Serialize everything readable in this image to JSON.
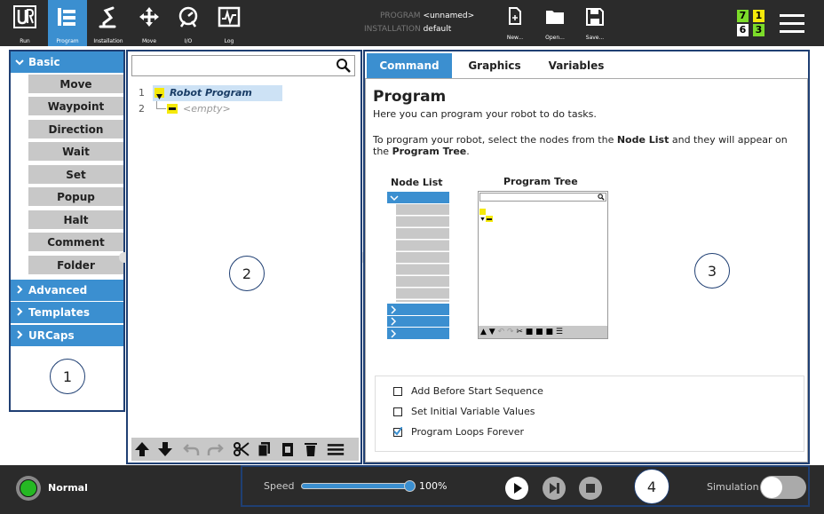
{
  "toolbar": {
    "run_label": "Run",
    "program_label": "Program",
    "installation_label": "Installation",
    "move_label": "Move",
    "io_label": "I/O",
    "log_label": "Log"
  },
  "program_info": {
    "program_key": "PROGRAM",
    "program_value": "<unnamed>",
    "installation_key": "INSTALLATION",
    "installation_value": "default"
  },
  "file_buttons": {
    "new_label": "New...",
    "open_label": "Open...",
    "save_label": "Save..."
  },
  "status_numbers": {
    "a": "7",
    "b": "1",
    "c": "6",
    "d": "3",
    "colors": {
      "green": "#7cdc2a",
      "yellow": "#f5e90a"
    }
  },
  "sidebar": {
    "basic_label": "Basic",
    "items": [
      "Move",
      "Waypoint",
      "Direction",
      "Wait",
      "Set",
      "Popup",
      "Halt",
      "Comment",
      "Folder"
    ],
    "advanced_label": "Advanced",
    "templates_label": "Templates",
    "urcaps_label": "URCaps"
  },
  "callouts": {
    "one": "1",
    "two": "2",
    "three": "3",
    "four": "4"
  },
  "tree": {
    "line1_num": "1",
    "line1_text": "Robot Program",
    "line2_num": "2",
    "line2_text": "<empty>"
  },
  "tabs": {
    "command": "Command",
    "graphics": "Graphics",
    "variables": "Variables"
  },
  "content": {
    "title": "Program",
    "subtitle": "Here you can program your robot to do tasks.",
    "instr_1": "To program your robot, select the nodes from the ",
    "instr_bold1": "Node List",
    "instr_2": " and they will appear on",
    "instr_3": "the ",
    "instr_bold2": "Program Tree",
    "instr_4": ".",
    "node_list_label": "Node List",
    "program_tree_label": "Program Tree"
  },
  "options": {
    "add_before": "Add Before Start Sequence",
    "initial_vars": "Set Initial Variable Values",
    "loops_forever": "Program Loops Forever",
    "add_before_checked": false,
    "initial_vars_checked": false,
    "loops_forever_checked": true
  },
  "bottom": {
    "status_label": "Normal",
    "speed_label": "Speed",
    "speed_value": "100%",
    "speed_fraction": 1.0,
    "simulation_label": "Simulation"
  },
  "colors": {
    "accent": "#3b8fd0",
    "dark": "#2b2b2b",
    "frame": "#1f3f73"
  }
}
